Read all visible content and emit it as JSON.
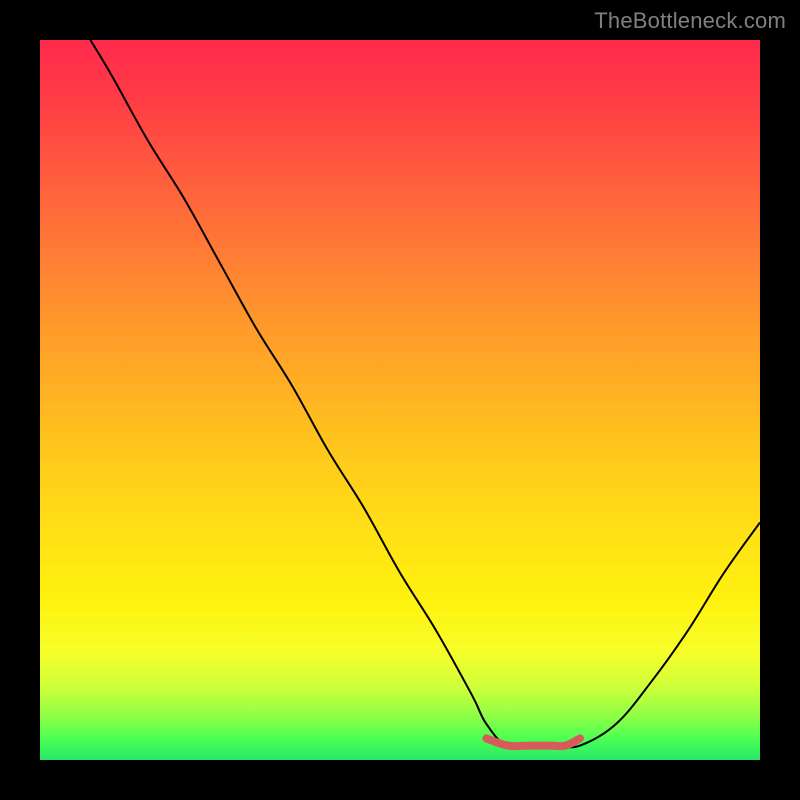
{
  "watermark": "TheBottleneck.com",
  "chart_data": {
    "type": "line",
    "title": "",
    "xlabel": "",
    "ylabel": "",
    "xlim": [
      0,
      100
    ],
    "ylim": [
      0,
      100
    ],
    "grid": false,
    "series": [
      {
        "name": "bottleneck-curve",
        "x": [
          7,
          10,
          15,
          20,
          25,
          30,
          35,
          40,
          45,
          50,
          55,
          60,
          62,
          65,
          70,
          72,
          75,
          80,
          85,
          90,
          95,
          100
        ],
        "y": [
          100,
          95,
          86,
          78,
          69,
          60,
          52,
          43,
          35,
          26,
          18,
          9,
          5,
          2,
          2,
          2,
          2,
          5,
          11,
          18,
          26,
          33
        ]
      }
    ],
    "highlight": {
      "name": "optimal-flat-region",
      "x": [
        62,
        65,
        68,
        71,
        73,
        75
      ],
      "y": [
        3,
        2,
        2,
        2,
        2,
        3
      ],
      "color": "#d85a5a",
      "stroke_width": 8
    }
  }
}
